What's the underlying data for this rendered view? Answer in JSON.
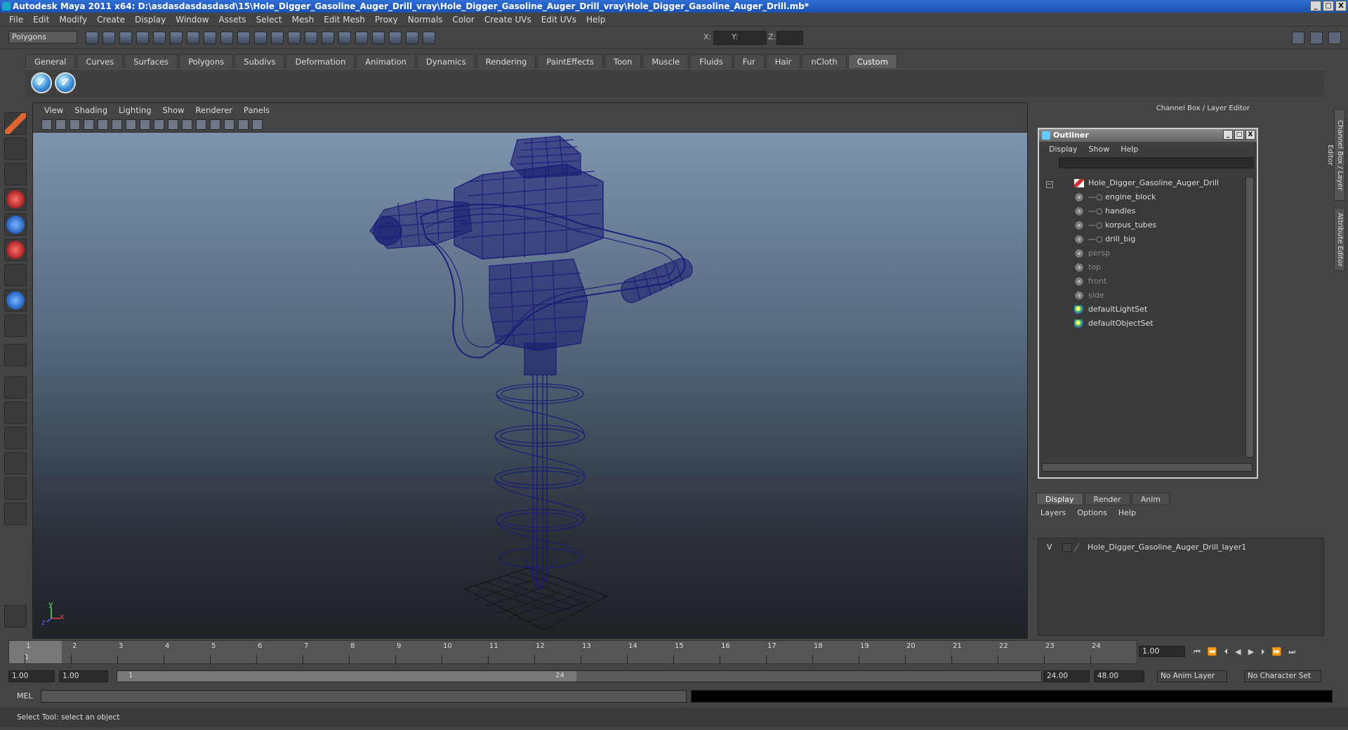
{
  "window": {
    "title": "Autodesk Maya 2011 x64: D:\\asdasdasdasdasd\\15\\Hole_Digger_Gasoline_Auger_Drill_vray\\Hole_Digger_Gasoline_Auger_Drill_vray\\Hole_Digger_Gasoline_Auger_Drill.mb*",
    "min": "_",
    "max": "□",
    "close": "X"
  },
  "menus": [
    "File",
    "Edit",
    "Modify",
    "Create",
    "Display",
    "Window",
    "Assets",
    "Select",
    "Mesh",
    "Edit Mesh",
    "Proxy",
    "Normals",
    "Color",
    "Create UVs",
    "Edit UVs",
    "Help"
  ],
  "status": {
    "mode": "Polygons",
    "x_label": "X:",
    "y_label": "Y:",
    "z_label": "Z:"
  },
  "shelf": {
    "tabs": [
      "General",
      "Curves",
      "Surfaces",
      "Polygons",
      "Subdivs",
      "Deformation",
      "Animation",
      "Dynamics",
      "Rendering",
      "PaintEffects",
      "Toon",
      "Muscle",
      "Fluids",
      "Fur",
      "Hair",
      "nCloth",
      "Custom"
    ],
    "active": "Custom"
  },
  "viewport": {
    "menus": [
      "View",
      "Shading",
      "Lighting",
      "Show",
      "Renderer",
      "Panels"
    ],
    "axis_y": "y",
    "axis_x": "x",
    "axis_z": "z",
    "wire_color": "#1a1a7a"
  },
  "panel": {
    "header": "Channel Box / Layer Editor",
    "side_tab1": "Channel Box / Layer Editor",
    "side_tab2": "Attribute Editor"
  },
  "outliner": {
    "title": "Outliner",
    "menus": [
      "Display",
      "Show",
      "Help"
    ],
    "items": [
      {
        "label": "Hole_Digger_Gasoline_Auger_Drill",
        "dim": false,
        "indent": 0,
        "type": "grp"
      },
      {
        "label": "engine_block",
        "dim": false,
        "indent": 1,
        "type": "mesh"
      },
      {
        "label": "handles",
        "dim": false,
        "indent": 1,
        "type": "mesh"
      },
      {
        "label": "korpus_tubes",
        "dim": false,
        "indent": 1,
        "type": "mesh"
      },
      {
        "label": "drill_big",
        "dim": false,
        "indent": 1,
        "type": "mesh"
      },
      {
        "label": "persp",
        "dim": true,
        "indent": 0,
        "type": "cam"
      },
      {
        "label": "top",
        "dim": true,
        "indent": 0,
        "type": "cam"
      },
      {
        "label": "front",
        "dim": true,
        "indent": 0,
        "type": "cam"
      },
      {
        "label": "side",
        "dim": true,
        "indent": 0,
        "type": "cam"
      },
      {
        "label": "defaultLightSet",
        "dim": false,
        "indent": 0,
        "type": "set"
      },
      {
        "label": "defaultObjectSet",
        "dim": false,
        "indent": 0,
        "type": "set"
      }
    ]
  },
  "layers": {
    "tabs": [
      "Display",
      "Render",
      "Anim"
    ],
    "active": "Display",
    "menus": [
      "Layers",
      "Options",
      "Help"
    ],
    "row": {
      "v": "V",
      "name": "Hole_Digger_Gasoline_Auger_Drill_layer1"
    }
  },
  "timeline": {
    "ticks": [
      "1",
      "2",
      "3",
      "4",
      "5",
      "6",
      "7",
      "8",
      "9",
      "10",
      "11",
      "12",
      "13",
      "14",
      "15",
      "16",
      "17",
      "18",
      "19",
      "20",
      "21",
      "22",
      "23",
      "24"
    ],
    "current": "1",
    "current_field": "1.00"
  },
  "range": {
    "start": "1.00",
    "play_start": "1.00",
    "slider_start": "1",
    "slider_end": "24",
    "play_end": "24.00",
    "end": "48.00",
    "anim_layer": "No Anim Layer",
    "char_set": "No Character Set"
  },
  "command": {
    "label": "MEL"
  },
  "statusbar": {
    "text": "Select Tool: select an object"
  }
}
